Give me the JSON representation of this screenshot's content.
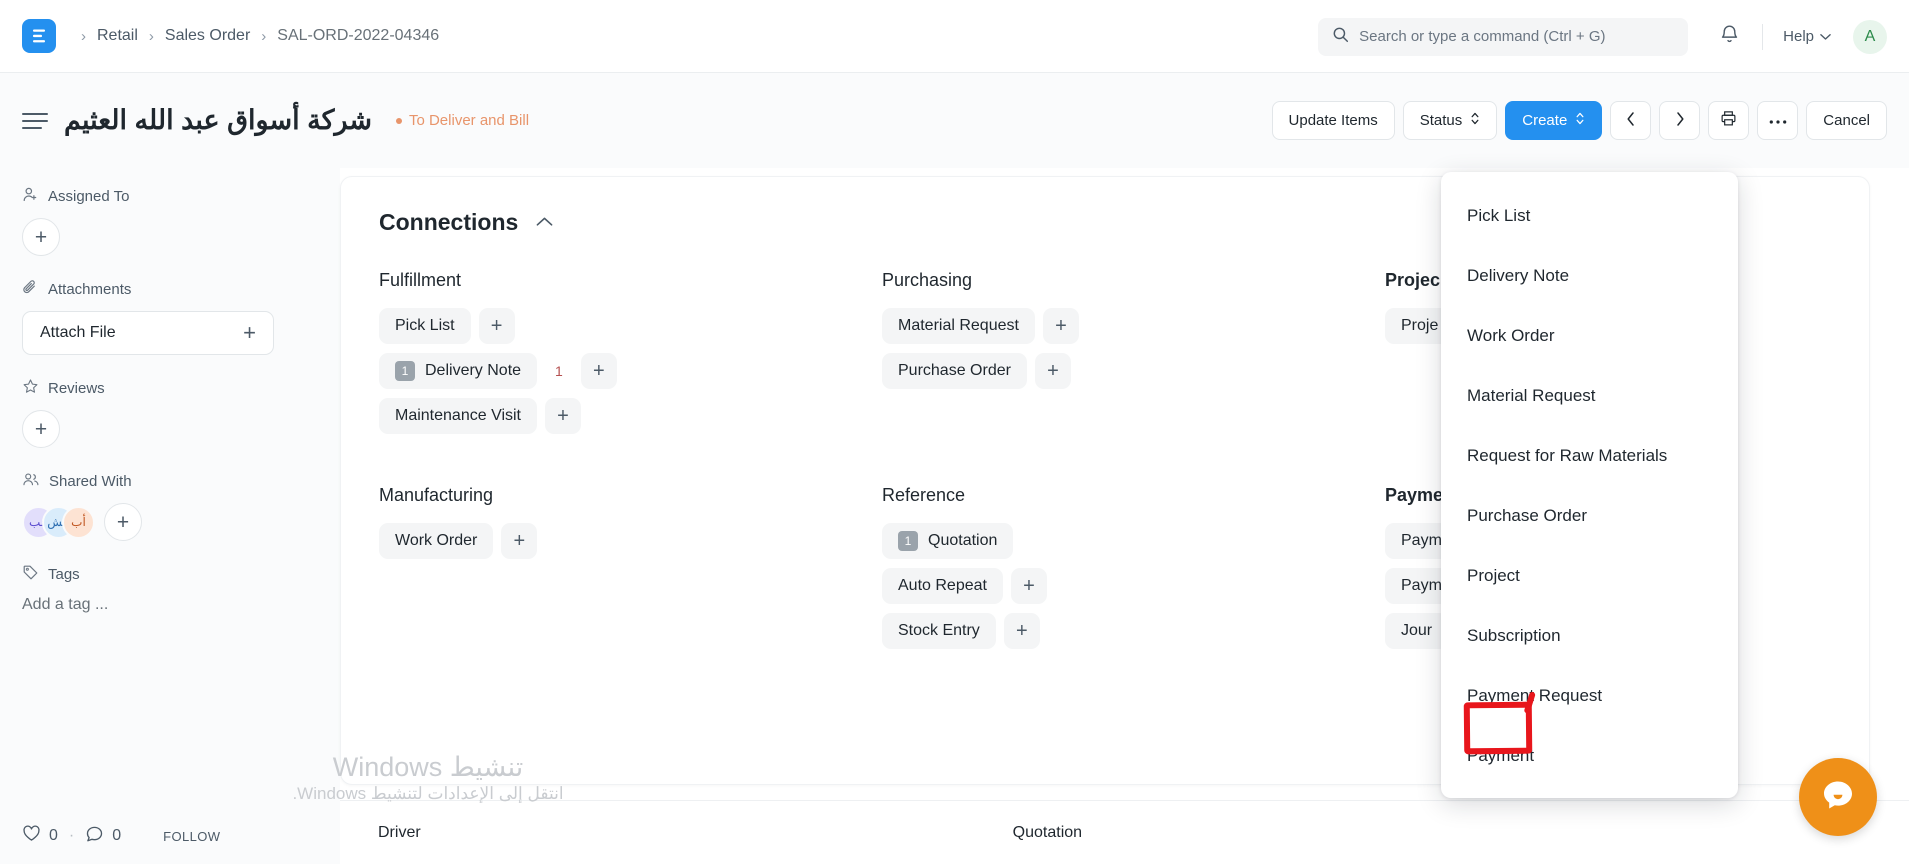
{
  "navbar": {
    "logo_letter": "E",
    "breadcrumb": [
      {
        "label": "Retail"
      },
      {
        "label": "Sales Order"
      },
      {
        "label": "SAL-ORD-2022-04346"
      }
    ],
    "search": {
      "placeholder": "Search or type a command (Ctrl + G)",
      "value": "",
      "icon": "search-icon"
    },
    "bell_icon": "notification-bell-icon",
    "help_label": "Help",
    "avatar_letter": "A"
  },
  "page_head": {
    "menu_icon": "hamburger-menu-icon",
    "title": "شركة أسواق عبد الله العثيم",
    "status": "To Deliver and Bill",
    "status_color": "#e8956b",
    "actions": {
      "update_items": "Update Items",
      "status": "Status",
      "create": "Create",
      "prev_icon": "chevron-left-icon",
      "next_icon": "chevron-right-icon",
      "print_icon": "printer-icon",
      "more_icon": "ellipsis-icon",
      "cancel": "Cancel"
    }
  },
  "sidebar": {
    "assigned_to": {
      "label": "Assigned To",
      "icon": "user-plus-icon",
      "add": "+"
    },
    "attachments": {
      "label": "Attachments",
      "icon": "paperclip-icon",
      "attach_label": "Attach File",
      "add": "+"
    },
    "reviews": {
      "label": "Reviews",
      "icon": "star-icon",
      "add": "+"
    },
    "shared_with": {
      "label": "Shared With",
      "icon": "users-icon",
      "avatars": [
        "أب",
        "عش",
        "عب"
      ],
      "add": "+"
    },
    "tags": {
      "label": "Tags",
      "icon": "tag-icon",
      "placeholder": "Add a tag ..."
    },
    "footer": {
      "like_icon": "heart-icon",
      "like_count": "0",
      "separator": "·",
      "comment_icon": "comment-icon",
      "comment_count": "0",
      "follow_label": "FOLLOW"
    }
  },
  "connections": {
    "title": "Connections",
    "collapse_icon": "chevron-up-icon",
    "columns": [
      {
        "title": "Fulfillment",
        "items": [
          {
            "label": "Pick List",
            "badge": null,
            "count": null,
            "add": "+"
          },
          {
            "label": "Delivery Note",
            "badge": "1",
            "count": "1",
            "add": "+"
          },
          {
            "label": "Maintenance Visit",
            "badge": null,
            "count": null,
            "add": "+"
          }
        ]
      },
      {
        "title": "Purchasing",
        "items": [
          {
            "label": "Material Request",
            "badge": null,
            "count": null,
            "add": "+"
          },
          {
            "label": "Purchase Order",
            "badge": null,
            "count": null,
            "add": "+"
          }
        ]
      },
      {
        "title": "Project",
        "truncated_title": "Projec",
        "items": [
          {
            "label": "Project",
            "truncated": "Proje",
            "badge": null,
            "count": null,
            "add": null
          }
        ]
      },
      {
        "title": "Manufacturing",
        "items": [
          {
            "label": "Work Order",
            "badge": null,
            "count": null,
            "add": "+"
          }
        ]
      },
      {
        "title": "Reference",
        "items": [
          {
            "label": "Quotation",
            "badge": "1",
            "count": null,
            "add": null
          },
          {
            "label": "Auto Repeat",
            "badge": null,
            "count": null,
            "add": "+"
          },
          {
            "label": "Stock Entry",
            "badge": null,
            "count": null,
            "add": "+"
          }
        ]
      },
      {
        "title": "Payments",
        "truncated_title": "Payme",
        "items": [
          {
            "label": "Payment Entry",
            "truncated": "Paym",
            "badge": null,
            "count": null,
            "add": null
          },
          {
            "label": "Payment Request",
            "truncated": "Paym",
            "badge": null,
            "count": null,
            "add": null
          },
          {
            "label": "Journal Entry",
            "truncated": "Jour",
            "badge": null,
            "count": null,
            "add": null
          }
        ]
      }
    ]
  },
  "create_dropdown": {
    "items": [
      {
        "label": "Pick List",
        "highlighted": false
      },
      {
        "label": "Delivery Note",
        "highlighted": false
      },
      {
        "label": "Work Order",
        "highlighted": false
      },
      {
        "label": "Material Request",
        "highlighted": false
      },
      {
        "label": "Request for Raw Materials",
        "highlighted": false
      },
      {
        "label": "Purchase Order",
        "highlighted": false
      },
      {
        "label": "Project",
        "highlighted": false
      },
      {
        "label": "Subscription",
        "highlighted": false
      },
      {
        "label": "Payment Request",
        "highlighted": false
      },
      {
        "label": "Payment",
        "highlighted": true
      }
    ],
    "highlight_color": "#e8161c"
  },
  "bottom_strip": {
    "left_label": "Driver",
    "right_label": "Quotation"
  },
  "watermark": {
    "line1": "تنشيط Windows",
    "line2": "انتقل إلى الإعدادات لتنشيط Windows."
  },
  "chat": {
    "icon": "chat-bubble-icon",
    "color": "#ef9018"
  }
}
